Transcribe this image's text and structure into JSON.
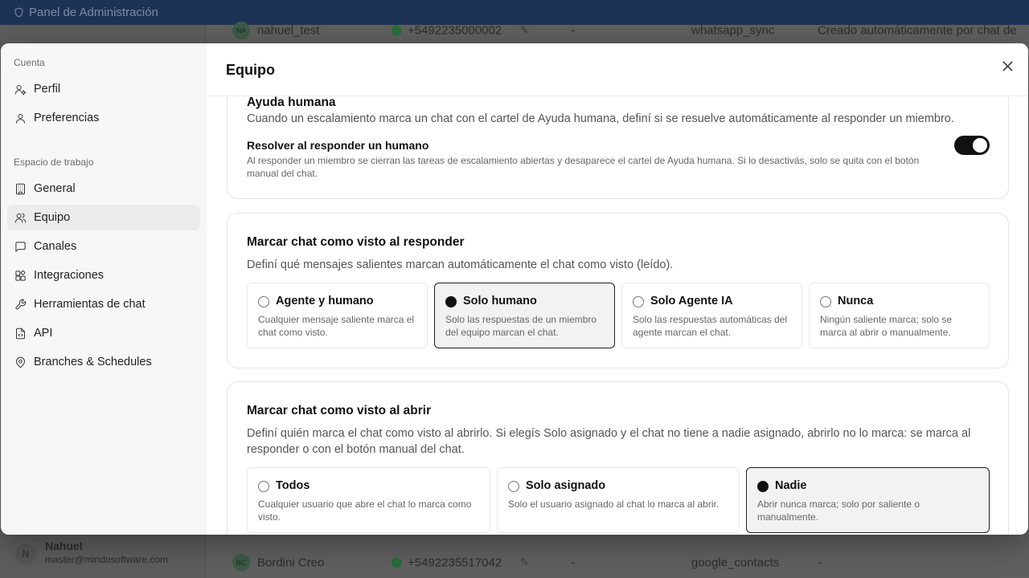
{
  "background": {
    "app_title": "Panel de Administración",
    "rows": [
      {
        "initials": "NA",
        "name": "nahuel_test",
        "phone": "+5492235000002",
        "dash": "-",
        "source": "whatsapp_sync",
        "note": "Creado automáticamente por chat de"
      },
      {
        "initials": "BC",
        "name": "Bordini Creo",
        "phone": "+5492235517042",
        "dash": "-",
        "source": "google_contacts",
        "note": "-"
      }
    ],
    "user": {
      "initial": "N",
      "name": "Nahuel",
      "email": "master@mindosoftware.com"
    }
  },
  "sidebar": {
    "section_account": "Cuenta",
    "account_items": [
      {
        "label": "Perfil",
        "icon": "user-cog-icon"
      },
      {
        "label": "Preferencias",
        "icon": "user-icon"
      }
    ],
    "section_workspace": "Espacio de trabajo",
    "workspace_items": [
      {
        "label": "General",
        "icon": "building-icon"
      },
      {
        "label": "Equipo",
        "icon": "users-icon",
        "active": true
      },
      {
        "label": "Canales",
        "icon": "chat-icon"
      },
      {
        "label": "Integraciones",
        "icon": "blocks-icon"
      },
      {
        "label": "Herramientas de chat",
        "icon": "wrench-icon"
      },
      {
        "label": "API",
        "icon": "file-code-icon"
      },
      {
        "label": "Branches & Schedules",
        "icon": "map-pin-icon"
      }
    ]
  },
  "modal": {
    "title": "Equipo",
    "close_icon": "close-icon"
  },
  "help_card": {
    "title": "Ayuda humana",
    "description": "Cuando un escalamiento marca un chat con el cartel de Ayuda humana, definí si se resuelve automáticamente al responder un miembro.",
    "toggle_title": "Resolver al responder un humano",
    "toggle_description": "Al responder un miembro se cierran las tareas de escalamiento abiertas y desaparece el cartel de Ayuda humana. Si lo desactivás, solo se quita con el botón manual del chat.",
    "toggle_on": true
  },
  "reply_card": {
    "title": "Marcar chat como visto al responder",
    "description": "Definí qué mensajes salientes marcan automáticamente el chat como visto (leído).",
    "options": [
      {
        "label": "Agente y humano",
        "description": "Cualquier mensaje saliente marca el chat como visto.",
        "selected": false
      },
      {
        "label": "Solo humano",
        "description": "Solo las respuestas de un miembro del equipo marcan el chat.",
        "selected": true
      },
      {
        "label": "Solo Agente IA",
        "description": "Solo las respuestas automáticas del agente marcan el chat.",
        "selected": false
      },
      {
        "label": "Nunca",
        "description": "Ningún saliente marca; solo se marca al abrir o manualmente.",
        "selected": false
      }
    ]
  },
  "open_card": {
    "title": "Marcar chat como visto al abrir",
    "description": "Definí quién marca el chat como visto al abrirlo. Si elegís Solo asignado y el chat no tiene a nadie asignado, abrirlo no lo marca: se marca al responder o con el botón manual del chat.",
    "options": [
      {
        "label": "Todos",
        "description": "Cualquier usuario que abre el chat lo marca como visto.",
        "selected": false
      },
      {
        "label": "Solo asignado",
        "description": "Solo el usuario asignado al chat lo marca al abrir.",
        "selected": false
      },
      {
        "label": "Nadie",
        "description": "Abrir nunca marca; solo por saliente o manualmente.",
        "selected": true
      }
    ]
  }
}
